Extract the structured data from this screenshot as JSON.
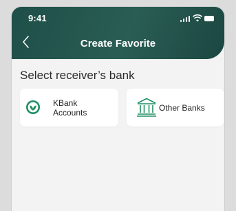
{
  "status_bar": {
    "time": "9:41"
  },
  "header": {
    "title": "Create Favorite"
  },
  "main": {
    "section_title": "Select receiver’s bank",
    "options": [
      {
        "label": "KBank Accounts"
      },
      {
        "label": "Other Banks"
      }
    ]
  },
  "colors": {
    "header_green": "#24544c",
    "accent_green": "#1f8f63",
    "background": "#f3f3f3"
  }
}
